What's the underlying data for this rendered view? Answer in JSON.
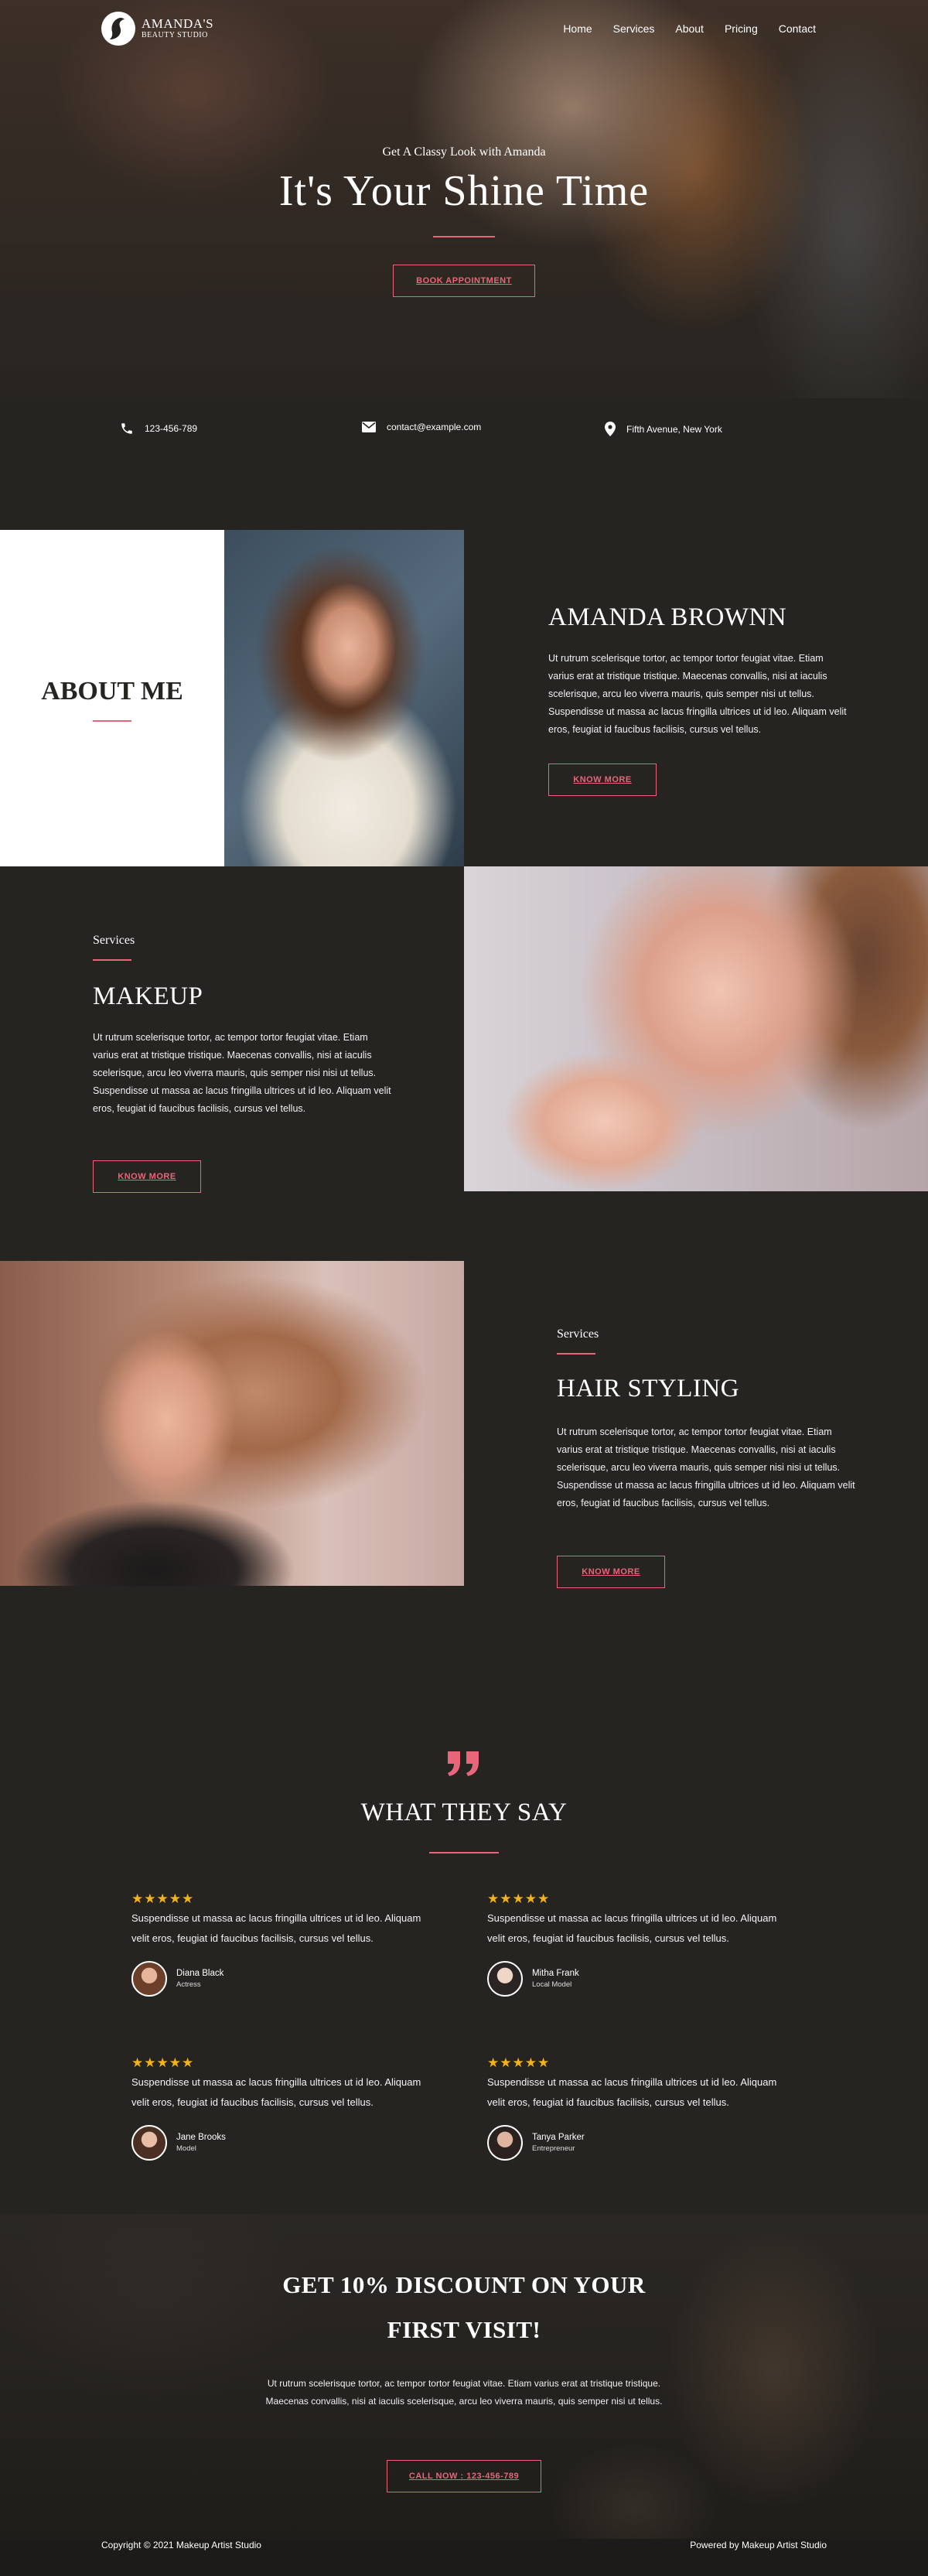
{
  "brand": {
    "name": "AMANDA'S",
    "tagline": "BEAUTY STUDIO"
  },
  "nav": {
    "items": [
      "Home",
      "Services",
      "About",
      "Pricing",
      "Contact"
    ]
  },
  "hero": {
    "subtitle": "Get A Classy Look with Amanda",
    "title": "It's Your Shine Time",
    "button": "BOOK APPOINTMENT"
  },
  "contact": {
    "phone": "123-456-789",
    "email": "contact@example.com",
    "address": "Fifth Avenue, New York"
  },
  "about": {
    "title": "ABOUT ME",
    "name": "AMANDA BROWNN",
    "text": "Ut rutrum scelerisque tortor, ac tempor tortor feugiat vitae. Etiam varius erat at tristique tristique. Maecenas convallis, nisi at iaculis scelerisque, arcu leo viverra mauris, quis semper nisi ut tellus. Suspendisse ut massa ac lacus fringilla ultrices ut id leo. Aliquam velit eros, feugiat id faucibus facilisis, cursus vel tellus.",
    "button": "KNOW MORE"
  },
  "makeup": {
    "label": "Services",
    "title": "MAKEUP",
    "text": "Ut rutrum scelerisque tortor, ac tempor tortor feugiat vitae. Etiam varius erat at tristique tristique. Maecenas convallis, nisi at iaculis scelerisque, arcu leo viverra mauris, quis semper nisi nisi ut tellus. Suspendisse ut massa ac lacus fringilla ultrices ut id leo. Aliquam velit eros, feugiat id faucibus facilisis, cursus vel tellus.",
    "button": "KNOW MORE"
  },
  "hair": {
    "label": "Services",
    "title": "HAIR STYLING",
    "text": "Ut rutrum scelerisque tortor, ac tempor tortor feugiat vitae. Etiam varius erat at tristique tristique. Maecenas convallis, nisi at iaculis scelerisque, arcu leo viverra mauris, quis semper nisi nisi ut tellus. Suspendisse ut massa ac lacus fringilla ultrices ut id leo. Aliquam velit eros, feugiat id faucibus facilisis, cursus vel tellus.",
    "button": "KNOW MORE"
  },
  "testimonials": {
    "title": "WHAT THEY SAY",
    "items": [
      {
        "stars": "★★★★★",
        "quote": "Suspendisse ut massa ac lacus fringilla ultrices ut id leo. Aliquam velit eros, feugiat id faucibus facilisis, cursus vel tellus.",
        "name": "Diana Black",
        "role": "Actress"
      },
      {
        "stars": "★★★★★",
        "quote": "Suspendisse ut massa ac lacus fringilla ultrices ut id leo. Aliquam velit eros, feugiat id faucibus facilisis, cursus vel tellus.",
        "name": "Mitha Frank",
        "role": "Local Model"
      },
      {
        "stars": "★★★★★",
        "quote": "Suspendisse ut massa ac lacus fringilla ultrices ut id leo. Aliquam velit eros, feugiat id faucibus facilisis, cursus vel tellus.",
        "name": "Jane Brooks",
        "role": "Model"
      },
      {
        "stars": "★★★★★",
        "quote": "Suspendisse ut massa ac lacus fringilla ultrices ut id leo. Aliquam velit eros, feugiat id faucibus facilisis, cursus vel tellus.",
        "name": "Tanya Parker",
        "role": "Entrepreneur"
      }
    ]
  },
  "cta": {
    "title_line1": "GET 10% DISCOUNT ON YOUR",
    "title_line2": "FIRST VISIT!",
    "text": "Ut rutrum scelerisque tortor, ac tempor tortor feugiat vitae. Etiam varius erat at tristique tristique. Maecenas convallis, nisi at iaculis scelerisque, arcu leo viverra mauris, quis semper nisi ut tellus.",
    "button": "CALL NOW : 123-456-789"
  },
  "footer": {
    "copyright": "Copyright © 2021 Makeup Artist Studio",
    "powered": "Powered by Makeup Artist Studio"
  },
  "colors": {
    "accent": "#e8657a",
    "background": "#262420",
    "star": "#f2b21d"
  },
  "icons": [
    "phone-icon",
    "envelope-icon",
    "location-pin-icon",
    "quote-icon",
    "logo-icon"
  ]
}
